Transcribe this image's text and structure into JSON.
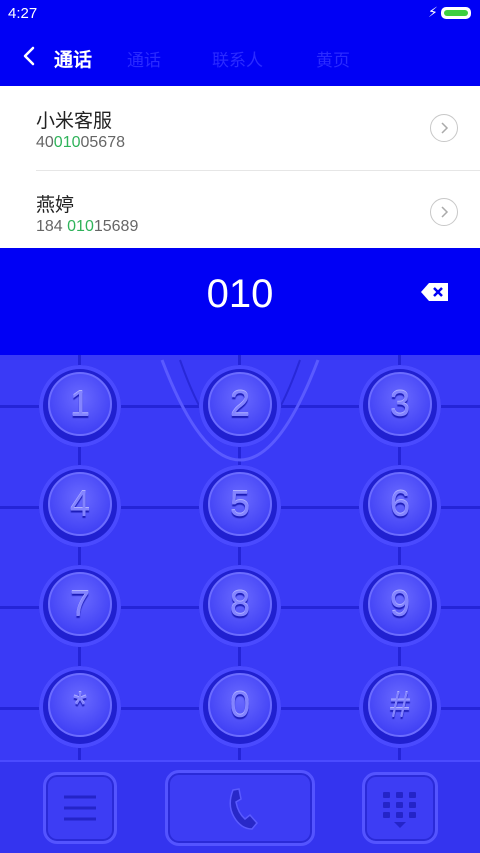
{
  "status_bar": {
    "time": "4:27"
  },
  "header": {
    "title": "通话",
    "tabs": [
      "通话",
      "联系人",
      "黄页"
    ]
  },
  "results": [
    {
      "name": "小米客服",
      "number_prefix": "40",
      "number_match": "010",
      "number_suffix": "05678"
    },
    {
      "name": "燕婷",
      "number_prefix": "184 ",
      "number_match": "010",
      "number_suffix": "15689"
    }
  ],
  "dialer": {
    "entered": "010"
  },
  "keypad": {
    "keys": [
      "1",
      "2",
      "3",
      "4",
      "5",
      "6",
      "7",
      "8",
      "9",
      "*",
      "0",
      "#"
    ]
  },
  "colors": {
    "accent": "#0000f5",
    "keypad": "#3a3af6",
    "match_highlight": "#2fb35a"
  }
}
